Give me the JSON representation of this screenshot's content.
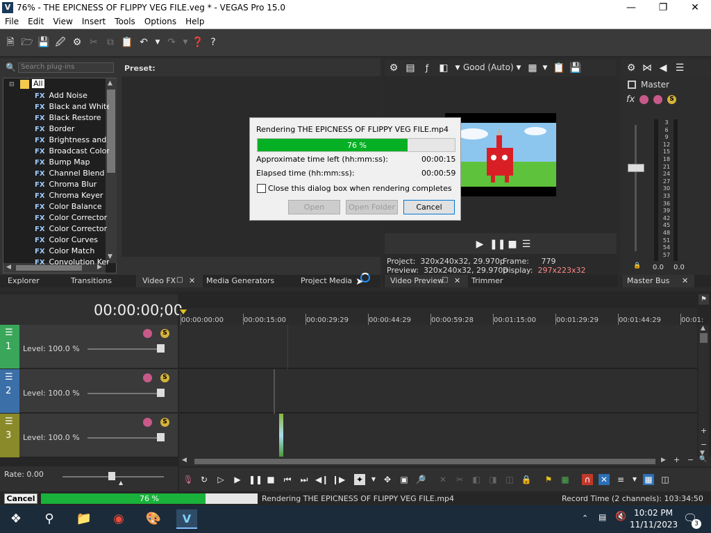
{
  "window": {
    "title": "76% - THE EPICNESS OF FLIPPY VEG FILE.veg * - VEGAS Pro 15.0",
    "logo_letter": "V"
  },
  "menu": [
    "File",
    "Edit",
    "View",
    "Insert",
    "Tools",
    "Options",
    "Help"
  ],
  "plugins": {
    "search_placeholder": "Search plug-ins",
    "preset_label": "Preset:",
    "root": "All",
    "items": [
      "Add Noise",
      "Black and White",
      "Black Restore",
      "Border",
      "Brightness and Co",
      "Broadcast Colors",
      "Bump Map",
      "Channel Blend",
      "Chroma Blur",
      "Chroma Keyer",
      "Color Balance",
      "Color Corrector",
      "Color Corrector (S",
      "Color Curves",
      "Color Match",
      "Convolution Kernel"
    ],
    "fx_badge": "FX"
  },
  "left_tabs": [
    "Explorer",
    "Transitions",
    "Video FX",
    "Media Generators",
    "Project Media"
  ],
  "preview": {
    "quality": "Good (Auto)",
    "project_label": "Project:",
    "project_value": "320x240x32, 29.970p",
    "preview_label": "Preview:",
    "preview_value": "320x240x32, 29.970p",
    "frame_label": "Frame:",
    "frame_value": "779",
    "display_label": "Display:",
    "display_value": "297x223x32",
    "tabs": [
      "Video Preview",
      "Trimmer"
    ]
  },
  "master": {
    "label": "Master",
    "scale": [
      "3",
      "6",
      "9",
      "12",
      "15",
      "18",
      "21",
      "24",
      "27",
      "30",
      "33",
      "36",
      "39",
      "42",
      "45",
      "48",
      "51",
      "54",
      "57"
    ],
    "left_value": "0.0",
    "right_value": "0.0",
    "tab": "Master Bus"
  },
  "dialog": {
    "title": "Rendering THE EPICNESS OF FLIPPY VEG FILE.mp4",
    "progress_pct": 76,
    "progress_text": "76 %",
    "time_left_label": "Approximate time left (hh:mm:ss):",
    "time_left": "00:00:15",
    "elapsed_label": "Elapsed time (hh:mm:ss):",
    "elapsed": "00:00:59",
    "close_checkbox": "Close this dialog box when rendering completes",
    "btn_open": "Open",
    "btn_open_folder": "Open Folder",
    "btn_cancel": "Cancel"
  },
  "timeline": {
    "timecode": "00:00:00;00",
    "ruler": [
      "00:00:00:00",
      "00:00:15:00",
      "00:00:29:29",
      "00:00:44:29",
      "00:00:59:28",
      "00:01:15:00",
      "00:01:29:29",
      "00:01:44:29",
      "00:01:"
    ],
    "tracks": [
      {
        "num": "1",
        "level": "Level: 100.0 %",
        "color": "#3aa65a"
      },
      {
        "num": "2",
        "level": "Level: 100.0 %",
        "color": "#3b6fa8"
      },
      {
        "num": "3",
        "level": "Level: 100.0 %",
        "color": "#8a8a2a"
      }
    ],
    "rate": "Rate: 0.00"
  },
  "status": {
    "cancel": "Cancel",
    "progress_pct": 76,
    "progress_text": "76 %",
    "message": "Rendering THE EPICNESS OF FLIPPY VEG FILE.mp4",
    "record_time": "Record Time (2 channels): 103:34:50"
  },
  "taskbar": {
    "time": "10:02 PM",
    "date": "11/11/2023",
    "notif_count": "3"
  },
  "colors": {
    "accent_green": "#19b23b",
    "progress_green": "#06b025"
  }
}
